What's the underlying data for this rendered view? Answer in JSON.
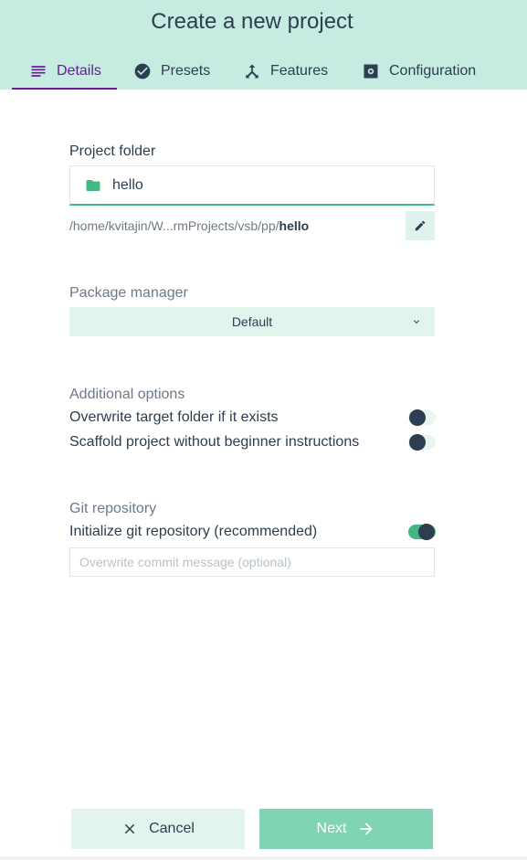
{
  "header": {
    "title": "Create a new project",
    "tabs": [
      {
        "label": "Details",
        "icon": "subject-icon",
        "active": true
      },
      {
        "label": "Presets",
        "icon": "check-circle-icon",
        "active": false
      },
      {
        "label": "Features",
        "icon": "call-split-icon",
        "active": false
      },
      {
        "label": "Configuration",
        "icon": "settings-icon",
        "active": false
      }
    ]
  },
  "project_folder": {
    "label": "Project folder",
    "value": "hello",
    "path_prefix": "/home/kvitajin/W...rmProjects/vsb/pp/",
    "path_name": "hello"
  },
  "package_manager": {
    "label": "Package manager",
    "selected": "Default"
  },
  "additional_options": {
    "title": "Additional options",
    "overwrite_label": "Overwrite target folder if it exists",
    "overwrite_on": false,
    "scaffold_label": "Scaffold project without beginner instructions",
    "scaffold_on": false
  },
  "git": {
    "title": "Git repository",
    "init_label": "Initialize git repository (recommended)",
    "init_on": true,
    "commit_placeholder": "Overwrite commit message (optional)"
  },
  "footer": {
    "cancel_label": "Cancel",
    "next_label": "Next"
  },
  "colors": {
    "header_bg": "#c6ebe0",
    "active_tab": "#6a1b9a",
    "accent": "#42b983",
    "text": "#2c3e50"
  }
}
